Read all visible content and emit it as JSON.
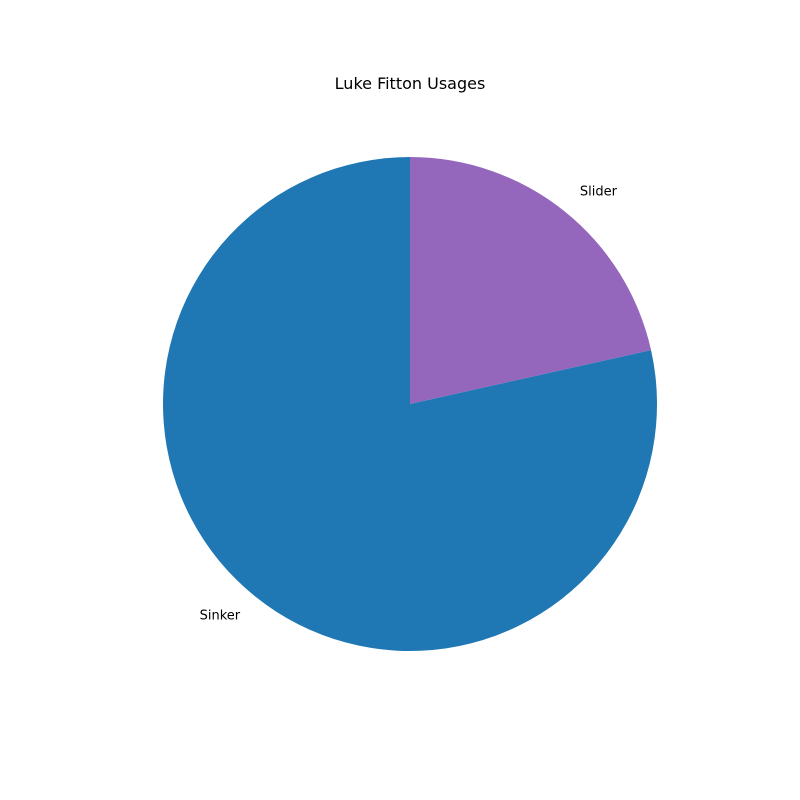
{
  "chart_data": {
    "type": "pie",
    "title": "Luke Fitton Usages",
    "slices": [
      {
        "label": "Slider",
        "value": 21.5,
        "color": "#9467bd"
      },
      {
        "label": "Sinker",
        "value": 78.5,
        "color": "#1f77b4"
      }
    ],
    "start_angle": "top",
    "direction": "clockwise"
  }
}
